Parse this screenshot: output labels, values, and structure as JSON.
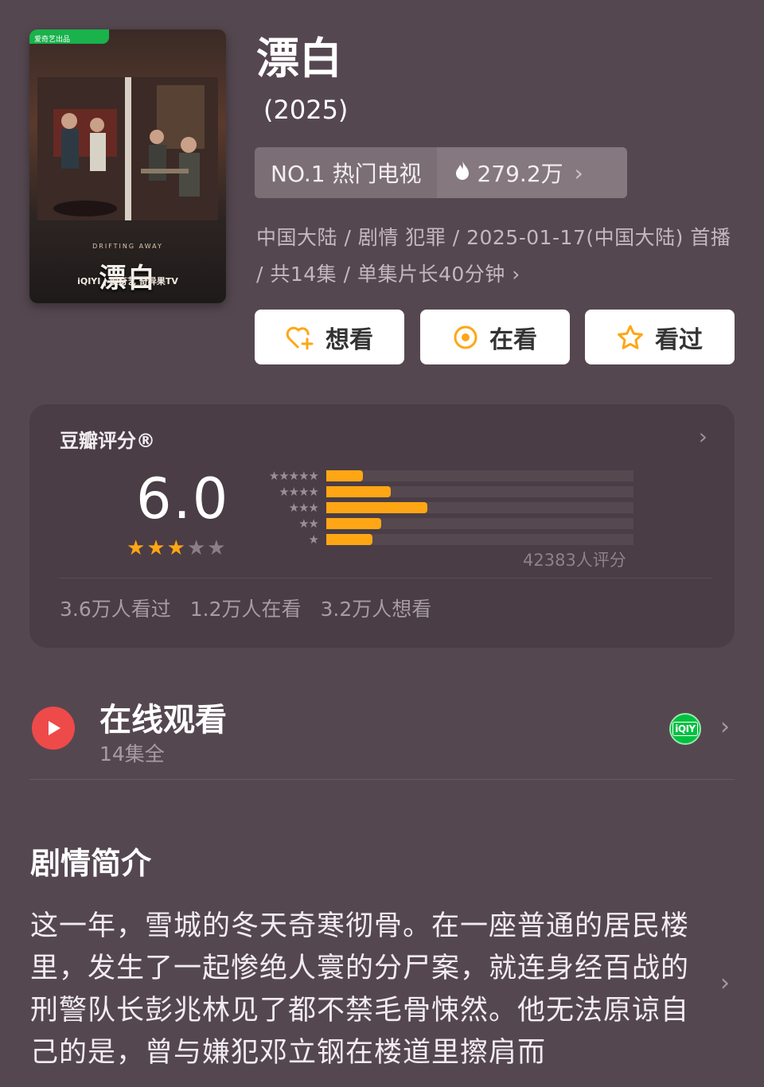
{
  "poster": {
    "brand_label": "爱奇艺出品",
    "title": "漂白",
    "subtitle_en": "DRIFTING AWAY",
    "platforms": "iQIYI | 爱奇艺  奇异果TV"
  },
  "show": {
    "title": "漂白",
    "year": "(2025)"
  },
  "rank": {
    "label": "NO.1 热门电视",
    "heat": "279.2万"
  },
  "meta": {
    "text": "中国大陆 / 剧情 犯罪 / 2025-01-17(中国大陆) 首播 / 共14集 / 单集片长40分钟"
  },
  "actions": {
    "want": "想看",
    "watching": "在看",
    "watched": "看过"
  },
  "rating": {
    "title": "豆瓣评分®",
    "score": "6.0",
    "stars_filled": 3,
    "stars_total": 5,
    "distribution": [
      {
        "stars": "★★★★★",
        "fraction": 0.12
      },
      {
        "stars": "★★★★",
        "fraction": 0.21
      },
      {
        "stars": "★★★",
        "fraction": 0.33
      },
      {
        "stars": "★★",
        "fraction": 0.18
      },
      {
        "stars": "★",
        "fraction": 0.15
      }
    ],
    "count": "42383人评分",
    "stats": [
      "3.6万人看过",
      "1.2万人在看",
      "3.2万人想看"
    ]
  },
  "online": {
    "title": "在线观看",
    "episodes": "14集全",
    "platform_badge": "iQIY"
  },
  "synopsis": {
    "heading": "剧情简介",
    "text": "这一年，雪城的冬天奇寒彻骨。在一座普通的居民楼里，发生了一起惨绝人寰的分尸案，就连身经百战的刑警队长彭兆林见了都不禁毛骨悚然。他无法原谅自己的是，曾与嫌犯邓立钢在楼道里擦肩而"
  },
  "colors": {
    "background": "#554750",
    "card": "#4a3d45",
    "accent": "#ffa615",
    "play": "#ee4a4a",
    "iqiyi": "#00c040"
  }
}
